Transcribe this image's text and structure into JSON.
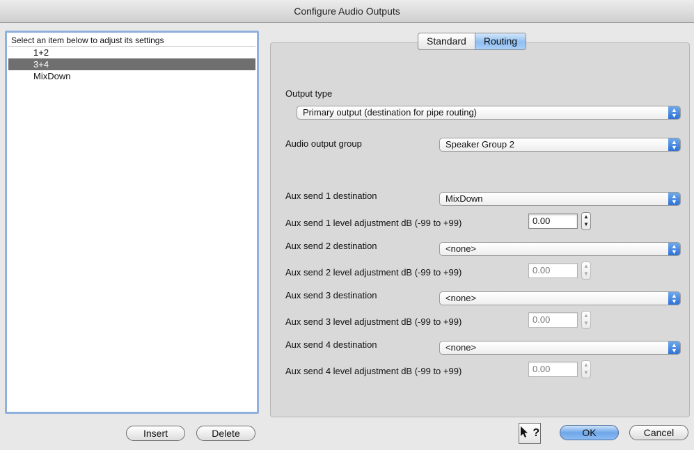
{
  "window": {
    "title": "Configure Audio Outputs"
  },
  "list": {
    "header": "Select an item below to adjust its settings",
    "items": [
      {
        "label": "1+2",
        "selected": false
      },
      {
        "label": "3+4",
        "selected": true
      },
      {
        "label": "MixDown",
        "selected": false
      }
    ]
  },
  "tabs": {
    "standard": "Standard",
    "routing": "Routing",
    "active": "Routing"
  },
  "routing": {
    "output_type_label": "Output type",
    "output_type_value": "Primary output (destination for pipe routing)",
    "audio_output_group_label": "Audio output group",
    "audio_output_group_value": "Speaker Group 2",
    "aux": [
      {
        "dest_label": "Aux send 1 destination",
        "dest_value": "MixDown",
        "level_label": "Aux send 1 level adjustment dB (-99 to +99)",
        "level_value": "0.00",
        "enabled": true
      },
      {
        "dest_label": "Aux send 2 destination",
        "dest_value": "<none>",
        "level_label": "Aux send 2 level adjustment dB (-99 to +99)",
        "level_value": "0.00",
        "enabled": false
      },
      {
        "dest_label": "Aux send 3 destination",
        "dest_value": "<none>",
        "level_label": "Aux send 3 level adjustment dB (-99 to +99)",
        "level_value": "0.00",
        "enabled": false
      },
      {
        "dest_label": "Aux send 4 destination",
        "dest_value": "<none>",
        "level_label": "Aux send 4 level adjustment dB (-99 to +99)",
        "level_value": "0.00",
        "enabled": false
      }
    ]
  },
  "buttons": {
    "insert": "Insert",
    "delete": "Delete",
    "help": "?",
    "ok": "OK",
    "cancel": "Cancel"
  },
  "icons": {
    "popup_arrows": "updown-arrows-icon",
    "help": "help-cursor-icon"
  },
  "colors": {
    "selection": "#6f6f6f",
    "accent": "#2f72d6",
    "focus_ring": "#8fb1dc"
  }
}
